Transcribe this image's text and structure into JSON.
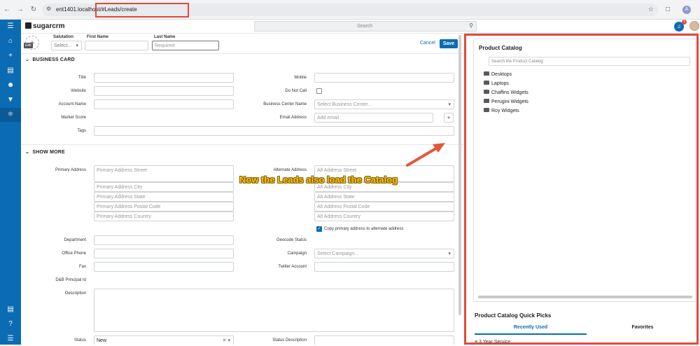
{
  "browser": {
    "url": "ent1401.localhost/#Leads/create",
    "profile_initial": "A"
  },
  "topbar": {
    "logo_text": "sugarcrm",
    "search_placeholder": "Search",
    "notification_count": "1"
  },
  "header": {
    "edit_label": "Edit",
    "salutation_label": "Salutation",
    "salutation_value": "Select...",
    "first_name_label": "First Name",
    "last_name_label": "Last Name",
    "last_name_placeholder": "Required",
    "cancel_label": "Cancel",
    "save_label": "Save"
  },
  "business_card": {
    "title": "BUSINESS CARD",
    "title_label": "Title",
    "mobile_label": "Mobile",
    "website_label": "Website",
    "do_not_call_label": "Do Not Call",
    "account_name_label": "Account Name",
    "business_center_label": "Business Center Name",
    "business_center_placeholder": "Select Business Center...",
    "market_score_label": "Market Score",
    "email_label": "Email Address",
    "email_placeholder": "Add email",
    "tags_label": "Tags"
  },
  "show_more": {
    "title": "SHOW MORE",
    "primary_address_label": "Primary Address",
    "primary_street": "Primary Address Street",
    "primary_city": "Primary Address City",
    "primary_state": "Primary Address State",
    "primary_postal": "Primary Address Postal Code",
    "primary_country": "Primary Address Country",
    "alternate_address_label": "Alternate Address",
    "alt_street": "Alt Address Street",
    "alt_city": "Alt Address City",
    "alt_state": "Alt Address State",
    "alt_postal": "Alt Address Postal Code",
    "alt_country": "Alt Address Country",
    "copy_address_label": "Copy primary address to alternate address",
    "department_label": "Department",
    "geocode_label": "Geocode Status",
    "office_phone_label": "Office Phone",
    "campaign_label": "Campaign",
    "campaign_placeholder": "Select Campaign...",
    "fax_label": "Fax",
    "twitter_label": "Twitter Account",
    "dnb_label": "D&B Principal Id",
    "description_label": "Description",
    "status_label": "Status",
    "status_value": "New",
    "status_description_label": "Status Description"
  },
  "annotation": {
    "text": "Now the Leads also load the Catalog"
  },
  "catalog": {
    "title": "Product Catalog",
    "search_placeholder": "Search the Product Catalog",
    "items": [
      "Desktops",
      "Laptops",
      "Chaffins Widgets",
      "Perugini Widgets",
      "Roy Widgets"
    ],
    "quick_picks_title": "Product Catalog Quick Picks",
    "tab_recent": "Recently Used",
    "tab_favorites": "Favorites",
    "quick_item": "3 Year Service"
  },
  "colors": {
    "accent": "#0b6cb3",
    "highlight_border": "#e24a3b",
    "annotation_text": "#f2c21b"
  }
}
